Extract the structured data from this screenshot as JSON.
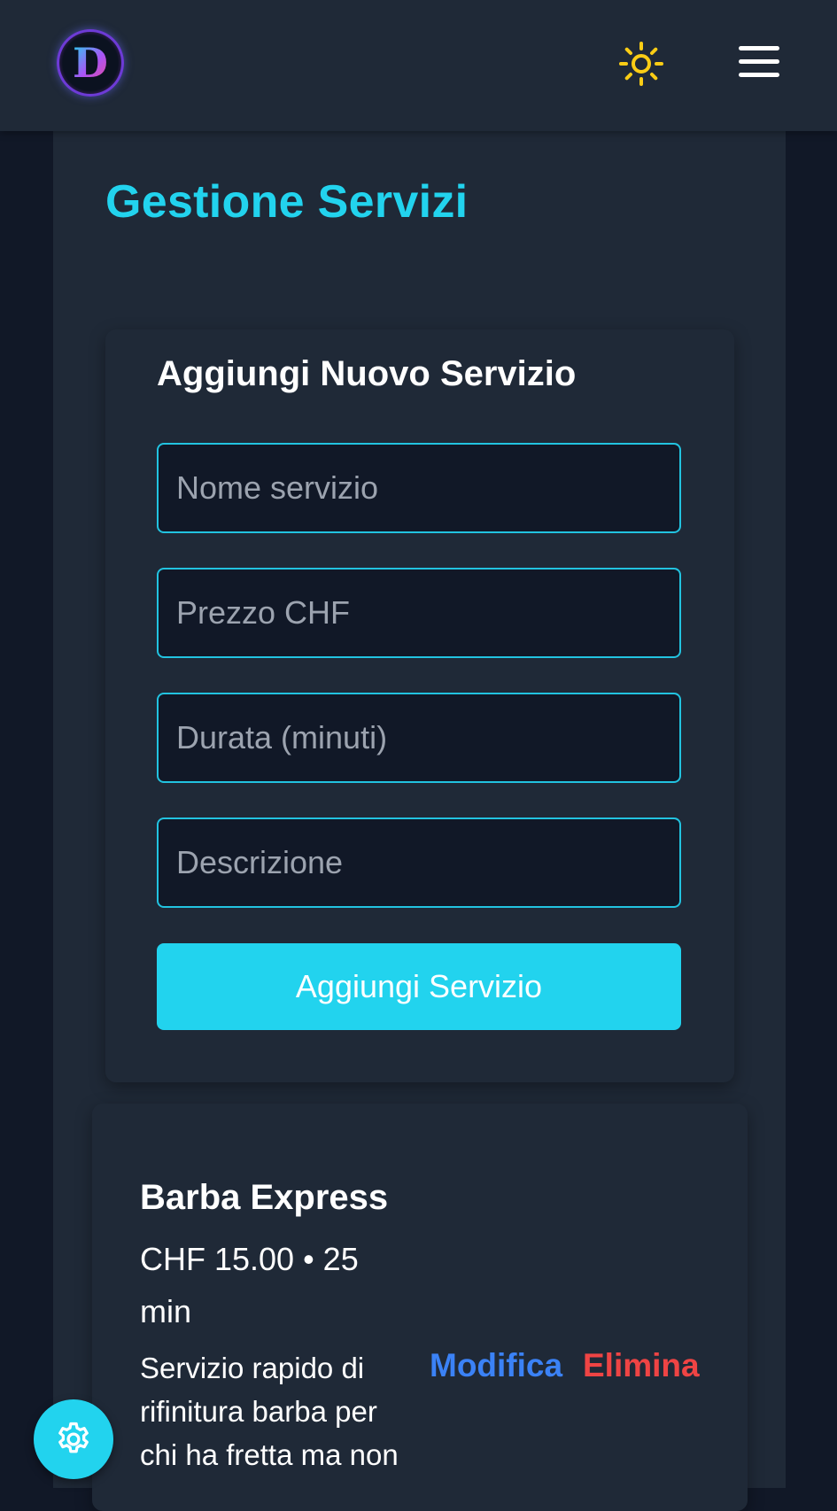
{
  "header": {
    "logo_letter": "D",
    "theme_toggle_icon": "sun-icon",
    "menu_icon": "hamburger-menu-icon"
  },
  "page": {
    "title": "Gestione Servizi"
  },
  "form": {
    "heading": "Aggiungi Nuovo Servizio",
    "name_placeholder": "Nome servizio",
    "price_placeholder": "Prezzo CHF",
    "duration_placeholder": "Durata (minuti)",
    "description_placeholder": "Descrizione",
    "submit_label": "Aggiungi Servizio"
  },
  "services": [
    {
      "name": "Barba Express",
      "meta": "CHF 15.00 • 25 min",
      "description": "Servizio rapido di rifinitura barba per chi ha fretta ma non",
      "edit_label": "Modifica",
      "delete_label": "Elimina"
    }
  ],
  "fab": {
    "icon": "gear-icon"
  },
  "colors": {
    "background": "#111827",
    "surface": "#1f2937",
    "accent": "#22d3ee",
    "edit": "#3b82f6",
    "delete": "#ef4444",
    "sun": "#facc15"
  }
}
